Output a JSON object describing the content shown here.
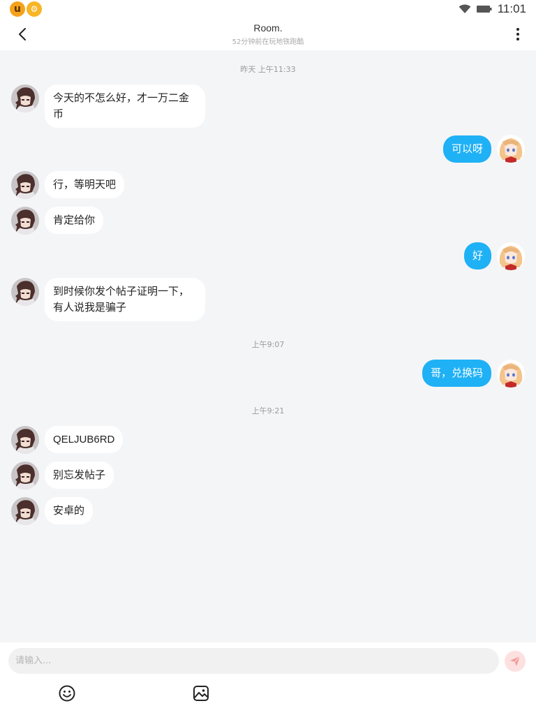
{
  "status_bar": {
    "time": "11:01",
    "app_badge_1": "u",
    "app_badge_2": "⚙"
  },
  "header": {
    "title": "Room.",
    "subtitle": "52分钟前在玩地铁跑酷"
  },
  "timestamps": [
    "昨天 上午11:33",
    "上午9:07",
    "上午9:21"
  ],
  "messages": [
    {
      "side": "in",
      "text": "今天的不怎么好，才一万二金币"
    },
    {
      "side": "out",
      "text": "可以呀"
    },
    {
      "side": "in",
      "text": "行，等明天吧"
    },
    {
      "side": "in",
      "text": "肯定给你"
    },
    {
      "side": "out",
      "text": "好"
    },
    {
      "side": "in",
      "text": "到时候你发个帖子证明一下，有人说我是骗子"
    },
    {
      "side": "out",
      "text": "哥，兑换码"
    },
    {
      "side": "in",
      "text": "QELJUB6RD"
    },
    {
      "side": "in",
      "text": "别忘发帖子"
    },
    {
      "side": "in",
      "text": "安卓的"
    }
  ],
  "input": {
    "placeholder": "请输入..."
  },
  "colors": {
    "outgoing_bubble": "#1fb1f5",
    "incoming_bubble": "#ffffff",
    "background": "#f4f5f7",
    "send_button": "#fde0e0",
    "send_icon": "#f39a9a"
  },
  "icons": {
    "back": "chevron-left-icon",
    "more": "more-vertical-icon",
    "send": "send-icon",
    "emoji": "emoji-icon",
    "image": "image-icon"
  }
}
